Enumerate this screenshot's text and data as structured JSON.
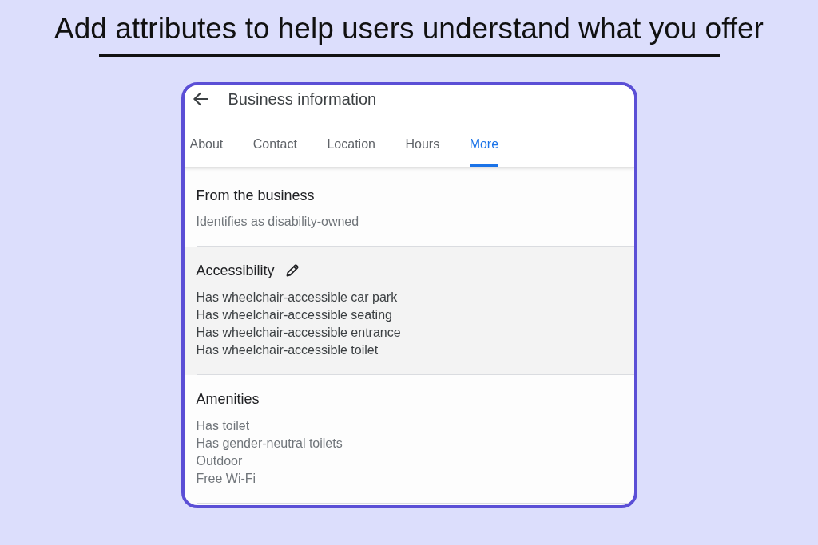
{
  "heading": "Add attributes to help users understand what you offer",
  "panel": {
    "title": "Business information",
    "tabs": [
      {
        "label": "About",
        "selected": false
      },
      {
        "label": "Contact",
        "selected": false
      },
      {
        "label": "Location",
        "selected": false
      },
      {
        "label": "Hours",
        "selected": false
      },
      {
        "label": "More",
        "selected": true
      }
    ],
    "sections": [
      {
        "title": "From the business",
        "highlighted": false,
        "editable": false,
        "items": [
          "Identifies as disability-owned"
        ]
      },
      {
        "title": "Accessibility",
        "highlighted": true,
        "editable": true,
        "items": [
          "Has wheelchair-accessible car park",
          "Has wheelchair-accessible seating",
          "Has wheelchair-accessible entrance",
          "Has wheelchair-accessible toilet"
        ]
      },
      {
        "title": "Amenities",
        "highlighted": false,
        "editable": false,
        "items": [
          "Has toilet",
          "Has gender-neutral toilets",
          "Outdoor",
          "Free Wi-Fi"
        ]
      }
    ]
  }
}
